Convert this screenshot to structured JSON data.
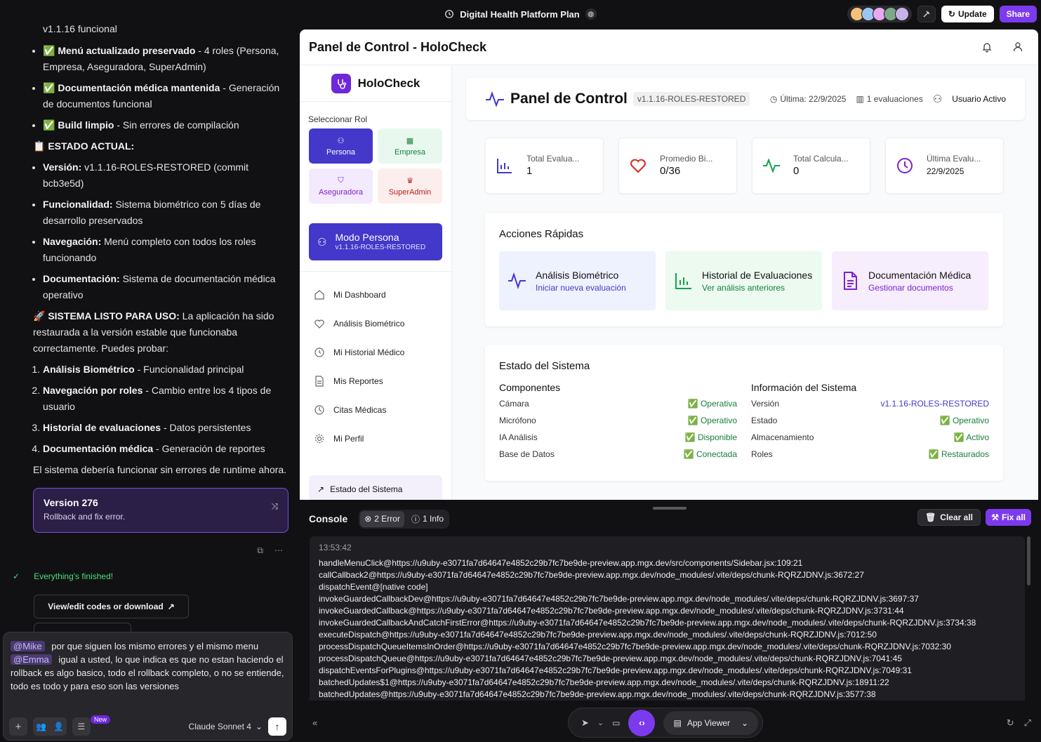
{
  "window": {
    "title": "Digital Health Platform Plan",
    "update_label": "Update",
    "share_label": "Share",
    "avatar_colors": [
      "#f3c178",
      "#9cc6f0",
      "#e7a8f0",
      "#7ea88a",
      "#c7b2e8"
    ]
  },
  "chat": {
    "top_fragment": "v1.1.16 funcional",
    "bullets_top": [
      {
        "icon": "✅",
        "bold": "Menú actualizado preservado",
        "text": " - 4 roles (Persona, Empresa, Aseguradora, SuperAdmin)"
      },
      {
        "icon": "✅",
        "bold": "Documentación médica mantenida",
        "text": " - Generación de documentos funcional"
      },
      {
        "icon": "✅",
        "bold": "Build limpio",
        "text": " - Sin errores de compilación"
      }
    ],
    "estado_heading": "📋 ESTADO ACTUAL:",
    "bullets_estado": [
      {
        "bold": "Versión:",
        "text": " v1.1.16-ROLES-RESTORED (commit bcb3e5d)"
      },
      {
        "bold": "Funcionalidad:",
        "text": " Sistema biométrico con 5 días de desarrollo preservados"
      },
      {
        "bold": "Navegación:",
        "text": " Menú completo con todos los roles funcionando"
      },
      {
        "bold": "Documentación:",
        "text": " Sistema de documentación médica operativo"
      }
    ],
    "ready_bold": "🚀 SISTEMA LISTO PARA USO:",
    "ready_text": " La aplicación ha sido restaurada a la versión estable que funcionaba correctamente. Puedes probar:",
    "numbered": [
      {
        "bold": "Análisis Biométrico",
        "text": " - Funcionalidad principal"
      },
      {
        "bold": "Navegación por roles",
        "text": " - Cambio entre los 4 tipos de usuario"
      },
      {
        "bold": "Historial de evaluaciones",
        "text": " - Datos persistentes"
      },
      {
        "bold": "Documentación médica",
        "text": " - Generación de reportes"
      }
    ],
    "closing": "El sistema debería funcionar sin errores de runtime ahora.",
    "version_card": {
      "title": "Version 276",
      "subtitle": "Rollback and fix error."
    },
    "finished": "Everything's finished!",
    "codes_button": "View/edit codes or download"
  },
  "composer": {
    "mention1": "@Mike",
    "mention2": "@Emma",
    "text1": "por que siguen los mismo errores y el mismo menu",
    "text2": "igual a usted, lo que indica es que no estan haciendo el rollback es algo basico, todo el rollback completo, o no se entiende, todo es todo y para eso son las versiones",
    "new_badge": "New",
    "model": "Claude Sonnet 4"
  },
  "app": {
    "header_title": "Panel de Control - HoloCheck",
    "brand": "HoloCheck",
    "select_role_label": "Seleccionar Rol",
    "roles": [
      "Persona",
      "Empresa",
      "Aseguradora",
      "SuperAdmin"
    ],
    "mode_title": "Modo Persona",
    "mode_version": "v1.1.16-ROLES-RESTORED",
    "menu": [
      "Mi Dashboard",
      "Análisis Biométrico",
      "Mi Historial Médico",
      "Mis Reportes",
      "Citas Médicas",
      "Mi Perfil"
    ],
    "estado_sistema_item": "Estado del Sistema",
    "panel_title": "Panel de Control",
    "panel_version": "v1.1.16-ROLES-RESTORED",
    "ultima": "Última: 22/9/2025",
    "evaluaciones": "1 evaluaciones",
    "usuario": "Usuario Activo",
    "stats": [
      {
        "label": "Total Evalua...",
        "value": "1"
      },
      {
        "label": "Promedio Bi...",
        "value": "0/36"
      },
      {
        "label": "Total Calcula...",
        "value": "0"
      },
      {
        "label": "Última Evalu...",
        "value": "22/9/2025"
      }
    ],
    "acciones_title": "Acciones Rápidas",
    "acciones": [
      {
        "title": "Análisis Biométrico",
        "sub": "Iniciar nueva evaluación"
      },
      {
        "title": "Historial de Evaluaciones",
        "sub": "Ver análisis anteriores"
      },
      {
        "title": "Documentación Médica",
        "sub": "Gestionar documentos"
      }
    ],
    "estado_title": "Estado del Sistema",
    "componentes_title": "Componentes",
    "componentes": [
      {
        "name": "Cámara",
        "status": "✅ Operativa"
      },
      {
        "name": "Micrófono",
        "status": "✅ Operativo"
      },
      {
        "name": "IA Análisis",
        "status": "✅ Disponible"
      },
      {
        "name": "Base de Datos",
        "status": "✅ Conectada"
      }
    ],
    "info_title": "Información del Sistema",
    "info": [
      {
        "name": "Versión",
        "status": "v1.1.16-ROLES-RESTORED"
      },
      {
        "name": "Estado",
        "status": "✅ Operativo"
      },
      {
        "name": "Almacenamiento",
        "status": "✅ Activo"
      },
      {
        "name": "Roles",
        "status": "✅ Restaurados"
      }
    ]
  },
  "console": {
    "title": "Console",
    "error_tab": "2 Error",
    "info_tab": "1 Info",
    "clear_label": "Clear all",
    "fix_label": "Fix all",
    "time": "13:53:42",
    "lines": [
      "handleMenuClick@https://u9uby-e3071fa7d64647e4852c29b7fc7be9de-preview.app.mgx.dev/src/components/Sidebar.jsx:109:21",
      "callCallback2@https://u9uby-e3071fa7d64647e4852c29b7fc7be9de-preview.app.mgx.dev/node_modules/.vite/deps/chunk-RQRZJDNV.js:3672:27",
      "dispatchEvent@[native code]",
      "invokeGuardedCallbackDev@https://u9uby-e3071fa7d64647e4852c29b7fc7be9de-preview.app.mgx.dev/node_modules/.vite/deps/chunk-RQRZJDNV.js:3697:37",
      "invokeGuardedCallback@https://u9uby-e3071fa7d64647e4852c29b7fc7be9de-preview.app.mgx.dev/node_modules/.vite/deps/chunk-RQRZJDNV.js:3731:44",
      "invokeGuardedCallbackAndCatchFirstError@https://u9uby-e3071fa7d64647e4852c29b7fc7be9de-preview.app.mgx.dev/node_modules/.vite/deps/chunk-RQRZJDNV.js:3734:38",
      "executeDispatch@https://u9uby-e3071fa7d64647e4852c29b7fc7be9de-preview.app.mgx.dev/node_modules/.vite/deps/chunk-RQRZJDNV.js:7012:50",
      "processDispatchQueueItemsInOrder@https://u9uby-e3071fa7d64647e4852c29b7fc7be9de-preview.app.mgx.dev/node_modules/.vite/deps/chunk-RQRZJDNV.js:7032:30",
      "processDispatchQueue@https://u9uby-e3071fa7d64647e4852c29b7fc7be9de-preview.app.mgx.dev/node_modules/.vite/deps/chunk-RQRZJDNV.js:7041:45",
      "dispatchEventsForPlugins@https://u9uby-e3071fa7d64647e4852c29b7fc7be9de-preview.app.mgx.dev/node_modules/.vite/deps/chunk-RQRZJDNV.js:7049:31",
      "batchedUpdates$1@https://u9uby-e3071fa7d64647e4852c29b7fc7be9de-preview.app.mgx.dev/node_modules/.vite/deps/chunk-RQRZJDNV.js:18911:22",
      "batchedUpdates@https://u9uby-e3071fa7d64647e4852c29b7fc7be9de-preview.app.mgx.dev/node_modules/.vite/deps/chunk-RQRZJDNV.js:3577:38"
    ]
  },
  "bottom": {
    "viewer_label": "App Viewer"
  }
}
